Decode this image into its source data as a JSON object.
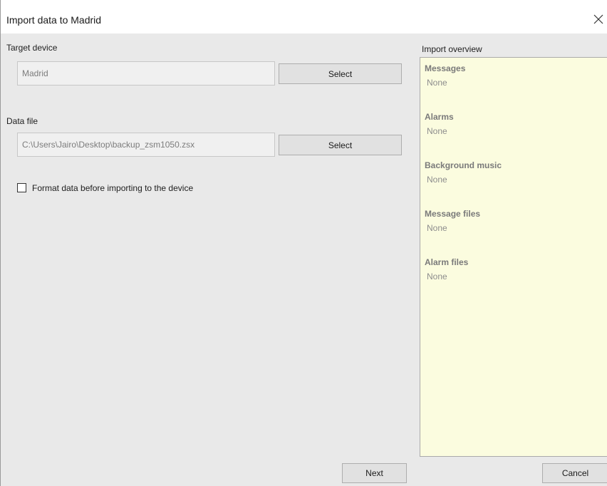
{
  "window": {
    "title": "Import data to Madrid",
    "close_icon": "close-icon"
  },
  "target_device": {
    "label": "Target device",
    "value": "Madrid",
    "select_label": "Select"
  },
  "data_file": {
    "label": "Data file",
    "value": "C:\\Users\\Jairo\\Desktop\\backup_zsm1050.zsx",
    "select_label": "Select"
  },
  "format_option": {
    "label": "Format data before importing to the device",
    "checked": false
  },
  "import_overview": {
    "label": "Import overview",
    "sections": [
      {
        "title": "Messages",
        "value": "None"
      },
      {
        "title": "Alarms",
        "value": "None"
      },
      {
        "title": "Background music",
        "value": "None"
      },
      {
        "title": "Message files",
        "value": "None"
      },
      {
        "title": "Alarm files",
        "value": "None"
      }
    ]
  },
  "footer": {
    "next_label": "Next",
    "cancel_label": "Cancel"
  },
  "colors": {
    "dialog_bg": "#e9e9e9",
    "overview_bg": "#fbfcdf",
    "input_bg": "#f0f0f0",
    "button_bg": "#e1e1e1"
  }
}
